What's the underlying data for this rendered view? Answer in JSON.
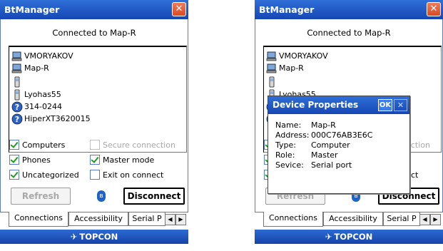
{
  "app": {
    "title": "BtManager",
    "close_glyph": "✕"
  },
  "status": "Connected to Map-R",
  "devices": [
    {
      "name": "VMORYAKOV",
      "icon": "computer-icon"
    },
    {
      "name": "Map-R",
      "icon": "computer-icon"
    },
    {
      "name": "",
      "icon": "phone-icon"
    },
    {
      "name": "Lyohas55",
      "icon": "phone-icon"
    },
    {
      "name": "314-0244",
      "icon": "unknown-device-icon"
    },
    {
      "name": "HiperXT3620015",
      "icon": "unknown-device-icon"
    }
  ],
  "options": {
    "computers": "Computers",
    "secure": "Secure connection",
    "phones": "Phones",
    "master": "Master mode",
    "uncategorized": "Uncategorized",
    "exit": "Exit on connect"
  },
  "buttons": {
    "refresh": "Refresh",
    "disconnect": "Disconnect",
    "bluetooth_glyph": "ʙ"
  },
  "tabs": {
    "connections": "Connections",
    "accessibility": "Accessibility",
    "serial": "Serial P",
    "left_arrow": "◀",
    "right_arrow": "▶"
  },
  "brand": {
    "mark": "✈",
    "name": "TOPCON"
  },
  "dialog": {
    "title": "Device Properties",
    "ok": "OK",
    "close": "✕",
    "rows": [
      {
        "key": "Name:",
        "value": "Map-R"
      },
      {
        "key": "Address:",
        "value": "000C76AB3E6C"
      },
      {
        "key": "Type:",
        "value": "Computer"
      },
      {
        "key": "Role:",
        "value": "Master"
      },
      {
        "key": "Sevice:",
        "value": "Serial port"
      }
    ]
  },
  "colors": {
    "title_bar": "#1f59c6",
    "close_button": "#e0552f",
    "check": "#1b9c1b"
  }
}
